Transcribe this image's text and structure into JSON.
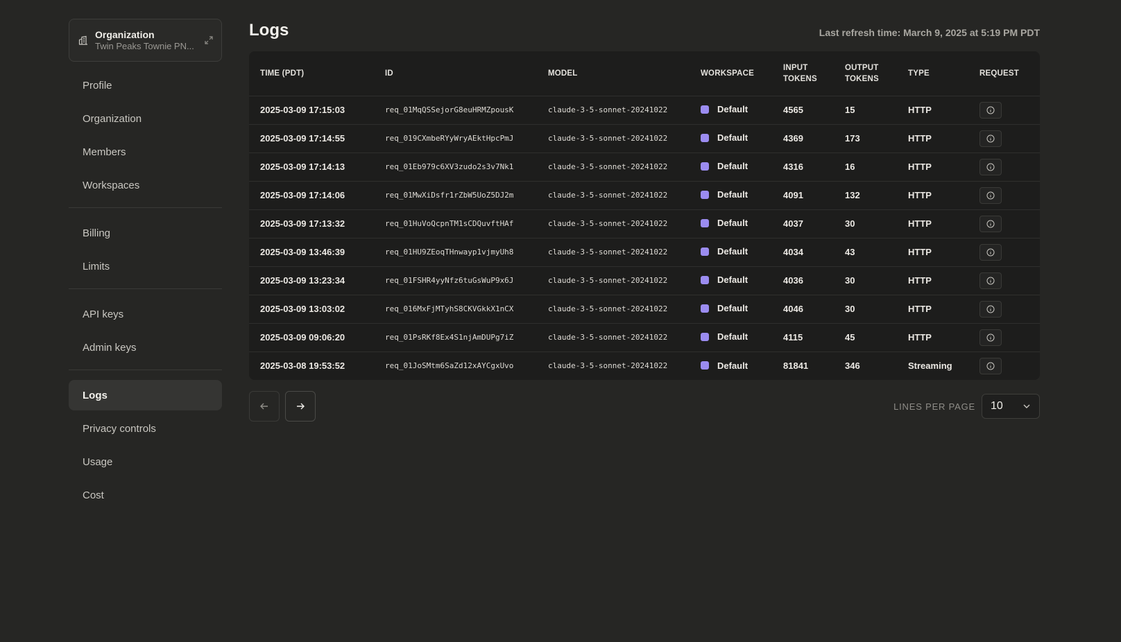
{
  "organization": {
    "title": "Organization",
    "subtitle": "Twin Peaks Townie PN..."
  },
  "sidebar": {
    "groups": [
      [
        "Profile",
        "Organization",
        "Members",
        "Workspaces"
      ],
      [
        "Billing",
        "Limits"
      ],
      [
        "API keys",
        "Admin keys"
      ],
      [
        "Logs",
        "Privacy controls",
        "Usage",
        "Cost"
      ]
    ],
    "active": "Logs"
  },
  "header": {
    "title": "Logs",
    "refresh": "Last refresh time: March 9, 2025 at 5:19 PM PDT"
  },
  "table": {
    "columns": [
      "TIME (PDT)",
      "ID",
      "MODEL",
      "WORKSPACE",
      "INPUT TOKENS",
      "OUTPUT TOKENS",
      "TYPE",
      "REQUEST"
    ],
    "rows": [
      [
        "2025-03-09 17:15:03",
        "req_01MqQSSejorG8euHRMZpousK",
        "claude-3-5-sonnet-20241022",
        "Default",
        "4565",
        "15",
        "HTTP"
      ],
      [
        "2025-03-09 17:14:55",
        "req_019CXmbeRYyWryAEktHpcPmJ",
        "claude-3-5-sonnet-20241022",
        "Default",
        "4369",
        "173",
        "HTTP"
      ],
      [
        "2025-03-09 17:14:13",
        "req_01Eb979c6XV3zudo2s3v7Nk1",
        "claude-3-5-sonnet-20241022",
        "Default",
        "4316",
        "16",
        "HTTP"
      ],
      [
        "2025-03-09 17:14:06",
        "req_01MwXiDsfr1rZbW5UoZ5DJ2m",
        "claude-3-5-sonnet-20241022",
        "Default",
        "4091",
        "132",
        "HTTP"
      ],
      [
        "2025-03-09 17:13:32",
        "req_01HuVoQcpnTM1sCDQuvftHAf",
        "claude-3-5-sonnet-20241022",
        "Default",
        "4037",
        "30",
        "HTTP"
      ],
      [
        "2025-03-09 13:46:39",
        "req_01HU9ZEoqTHnwayp1vjmyUh8",
        "claude-3-5-sonnet-20241022",
        "Default",
        "4034",
        "43",
        "HTTP"
      ],
      [
        "2025-03-09 13:23:34",
        "req_01FSHR4yyNfz6tuGsWuP9x6J",
        "claude-3-5-sonnet-20241022",
        "Default",
        "4036",
        "30",
        "HTTP"
      ],
      [
        "2025-03-09 13:03:02",
        "req_016MxFjMTyhS8CKVGkkX1nCX",
        "claude-3-5-sonnet-20241022",
        "Default",
        "4046",
        "30",
        "HTTP"
      ],
      [
        "2025-03-09 09:06:20",
        "req_01PsRKf8Ex4S1njAmDUPg7iZ",
        "claude-3-5-sonnet-20241022",
        "Default",
        "4115",
        "45",
        "HTTP"
      ],
      [
        "2025-03-08 19:53:52",
        "req_01JoSMtm6SaZd12xAYCgxUvo",
        "claude-3-5-sonnet-20241022",
        "Default",
        "81841",
        "346",
        "Streaming"
      ]
    ]
  },
  "pagination": {
    "lines_per_page_label": "LINES PER PAGE",
    "lines_per_page_value": "10"
  },
  "colors": {
    "background": "#262624",
    "table_background": "#1d1d1c",
    "workspace_dot": "#9b8cf0"
  }
}
